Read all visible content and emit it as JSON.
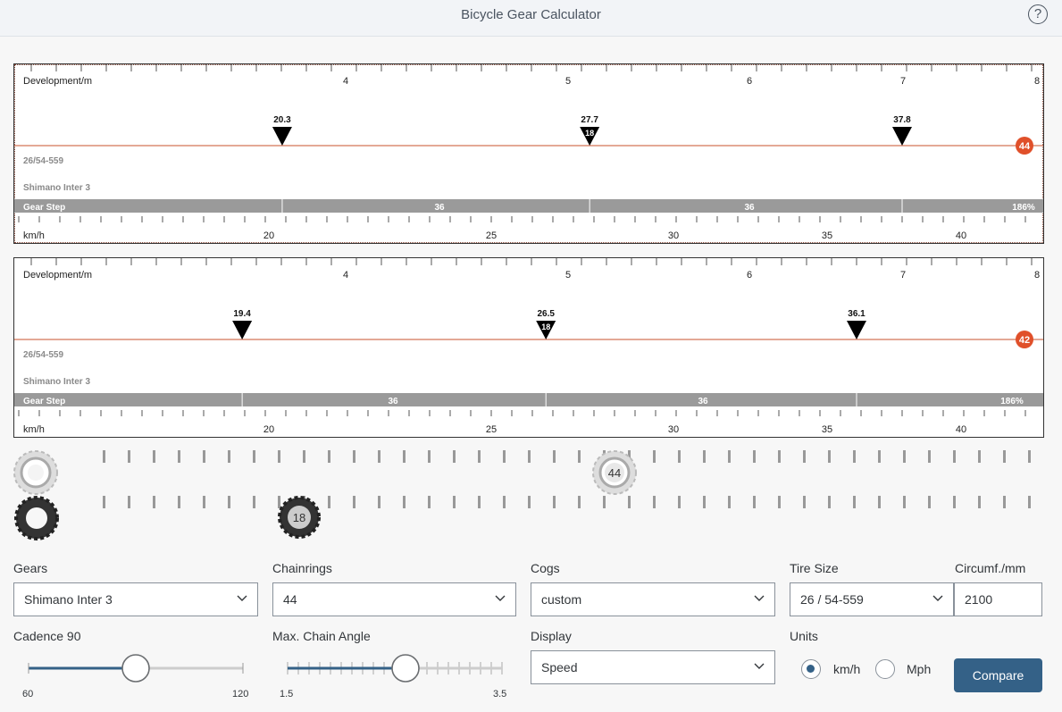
{
  "app": {
    "title": "Bicycle Gear Calculator"
  },
  "charts": [
    {
      "dev_label": "Development/m",
      "dev_ticks": [
        "4",
        "5",
        "6",
        "7",
        "8"
      ],
      "speeds": [
        "20.3",
        "27.7",
        "37.8"
      ],
      "speed_values": [
        20.3,
        27.7,
        37.8
      ],
      "mid_cog": "18",
      "chainring": "44",
      "tire": "26/54-559",
      "hub": "Shimano Inter 3",
      "gear_step_label": "Gear Step",
      "steps": [
        "36",
        "36",
        "186%"
      ],
      "kmh_label": "km/h",
      "kmh_ticks": [
        "20",
        "25",
        "30",
        "35",
        "40"
      ]
    },
    {
      "dev_label": "Development/m",
      "dev_ticks": [
        "4",
        "5",
        "6",
        "7",
        "8"
      ],
      "speeds": [
        "19.4",
        "26.5",
        "36.1"
      ],
      "speed_values": [
        19.4,
        26.5,
        36.1
      ],
      "mid_cog": "18",
      "chainring": "42",
      "tire": "26/54-559",
      "hub": "Shimano Inter 3",
      "gear_step_label": "Gear Step",
      "steps": [
        "36",
        "36",
        "186%"
      ],
      "kmh_label": "km/h",
      "kmh_ticks": [
        "20",
        "25",
        "30",
        "35",
        "40"
      ]
    }
  ],
  "gears_view": {
    "chainring_teeth": "44",
    "cog_teeth": "18"
  },
  "form": {
    "gears": {
      "label": "Gears",
      "value": "Shimano Inter 3"
    },
    "chainrings": {
      "label": "Chainrings",
      "value": "44"
    },
    "cogs": {
      "label": "Cogs",
      "value": "custom"
    },
    "tire": {
      "label": "Tire Size",
      "value": "26 / 54-559"
    },
    "circumf": {
      "label": "Circumf./mm",
      "value": "2100"
    },
    "cadence": {
      "label": "Cadence 90",
      "min": "60",
      "max": "120",
      "value": 90
    },
    "chain_angle": {
      "label": "Max. Chain Angle",
      "min": "1.5",
      "max": "3.5",
      "value": 2.6
    },
    "display": {
      "label": "Display",
      "value": "Speed"
    },
    "units": {
      "label": "Units",
      "kmh": "km/h",
      "mph": "Mph",
      "selected": "km/h"
    },
    "compare": "Compare"
  },
  "colors": {
    "accent": "#346187",
    "gear_line": "#c9502d",
    "badge": "#e0502a",
    "step_bar": "#9a9a9a"
  }
}
